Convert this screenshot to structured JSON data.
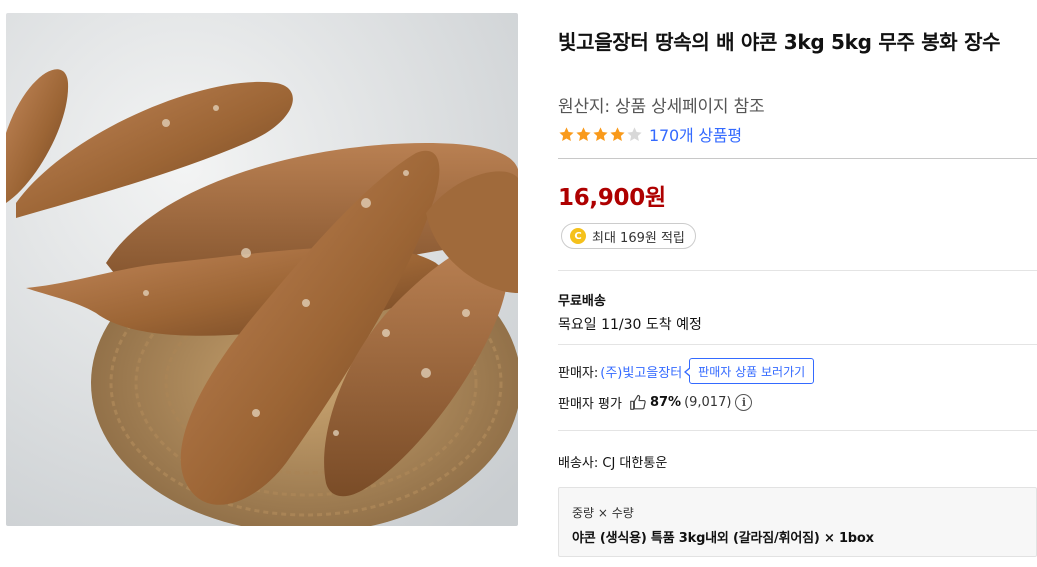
{
  "product": {
    "title": "빛고을장터 땅속의 배 야콘 3kg 5kg 무주 봉화 장수",
    "origin": "원산지: 상품 상세페이지 참조",
    "rating": 4,
    "review_count_text": "170개 상품평",
    "price": "16,900원",
    "reward_text": "최대 169원 적립",
    "coin_symbol": "C"
  },
  "shipping": {
    "label": "무료배송",
    "arrival": "목요일 11/30 도착 예정"
  },
  "seller": {
    "label": "판매자:",
    "name": "(주)빛고을장터",
    "view_button": "판매자 상품 보러가기",
    "eval_label": "판매자 평가",
    "eval_percent": "87%",
    "eval_count": "(9,017)",
    "info_symbol": "i"
  },
  "courier": "배송사: CJ 대한통운",
  "option": {
    "header": "중량 × 수량",
    "value": "야콘 (생식용) 특품 3kg내외 (갈라짐/휘어짐) × 1box"
  },
  "colors": {
    "price": "#ae0000",
    "link": "#346aff",
    "star": "#f99a1b",
    "coin": "#f5c11b"
  },
  "icons": {
    "star": "star-icon",
    "thumb": "thumbs-up-icon",
    "info": "info-icon",
    "coin": "coin-icon"
  }
}
